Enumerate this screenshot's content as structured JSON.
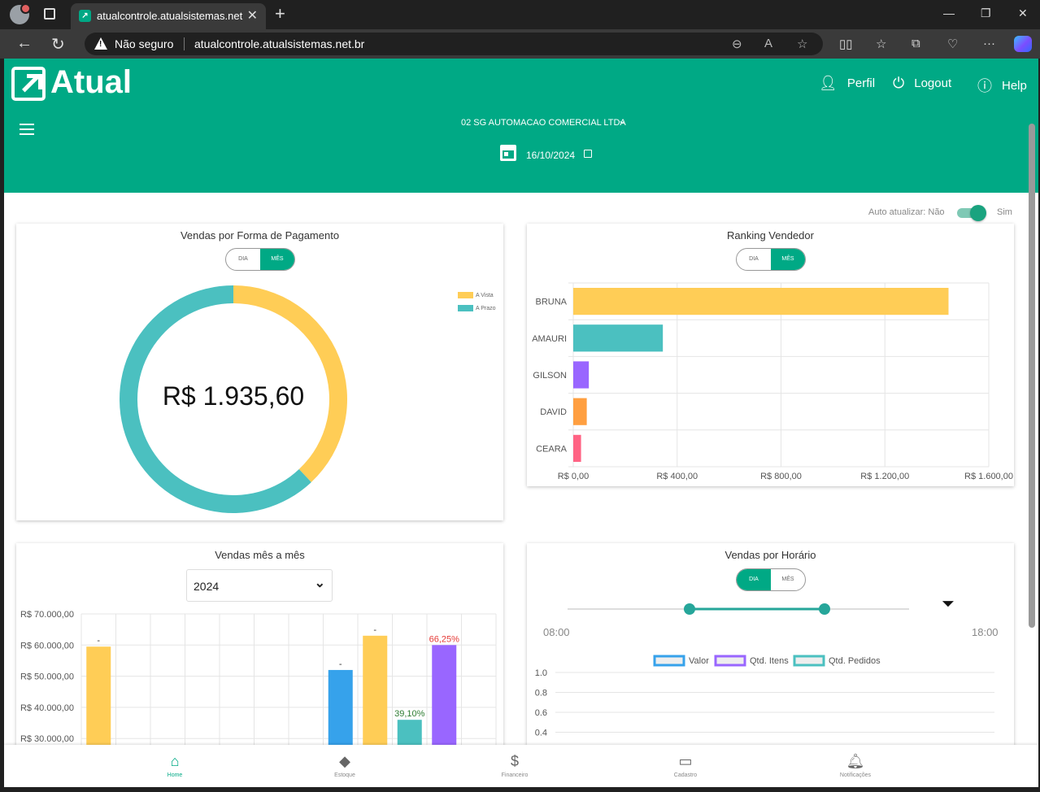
{
  "browser": {
    "tab_title": "atualcontrole.atualsistemas.net.br",
    "security": "Não seguro",
    "url": "atualcontrole.atualsistemas.net.br"
  },
  "header": {
    "logo_text": "Atual",
    "perfil": "Perfil",
    "logout": "Logout",
    "help": "Help",
    "company": "02 SG AUTOMACAO COMERCIAL LTDA",
    "date": "16/10/2024"
  },
  "auto_update": {
    "label": "Auto atualizar: Não",
    "on_label": "Sim",
    "enabled": true
  },
  "cards": {
    "payment": {
      "title": "Vendas por Forma de Pagamento",
      "seg_dia": "DIA",
      "seg_mes": "MÊS",
      "active": "MÊS",
      "total": "R$ 1.935,60"
    },
    "ranking": {
      "title": "Ranking Vendedor",
      "seg_dia": "DIA",
      "seg_mes": "MÊS",
      "active": "MÊS"
    },
    "monthly": {
      "title": "Vendas mês a mês",
      "year": "2024"
    },
    "hourly": {
      "title": "Vendas por Horário",
      "seg_dia": "DIA",
      "seg_mes": "MÊS",
      "active": "DIA",
      "start": "08:00",
      "end": "18:00"
    }
  },
  "bottom_nav": [
    {
      "label": "Home",
      "icon": "home-icon"
    },
    {
      "label": "Estoque",
      "icon": "tag-icon"
    },
    {
      "label": "Financeiro",
      "icon": "dollar-icon"
    },
    {
      "label": "Cadastro",
      "icon": "folder-icon"
    },
    {
      "label": "Notificações",
      "icon": "bell-icon"
    }
  ],
  "colors": {
    "brand": "#00a985",
    "yellow": "#ffcd56",
    "teal": "#4bc0c0",
    "purple": "#9966ff",
    "orange": "#ff9f40",
    "pink": "#ff6384",
    "blue": "#36a2eb"
  },
  "chart_data": [
    {
      "type": "pie",
      "title": "Vendas por Forma de Pagamento",
      "categories": [
        "A Vista",
        "A Prazo"
      ],
      "values": [
        38,
        62
      ],
      "colors": [
        "#ffcd56",
        "#4bc0c0"
      ],
      "legend": "top-right"
    },
    {
      "type": "bar",
      "title": "Ranking Vendedor",
      "orientation": "horizontal",
      "categories": [
        "BRUNA",
        "AMAURI",
        "GILSON",
        "DAVID",
        "CEARA"
      ],
      "values": [
        1445,
        345,
        60,
        52,
        30
      ],
      "colors": [
        "#ffcd56",
        "#4bc0c0",
        "#9966ff",
        "#ff9f40",
        "#ff6384"
      ],
      "ticks": [
        "R$ 0,00",
        "R$ 400,00",
        "R$ 800,00",
        "R$ 1.200,00",
        "R$ 1.600,00"
      ],
      "xlim": [
        0,
        1600
      ]
    },
    {
      "type": "bar",
      "title": "Vendas mês a mês",
      "slots": 12,
      "ticks": [
        "R$ 70.000,00",
        "R$ 60.000,00",
        "R$ 50.000,00",
        "R$ 40.000,00",
        "R$ 30.000,00"
      ],
      "ylim": [
        30000,
        70000
      ],
      "bars": [
        {
          "slot": 0,
          "value": 59500,
          "color": "#ffcd56",
          "label": "-",
          "label_color": "#333"
        },
        {
          "slot": 7,
          "value": 52000,
          "color": "#36a2eb",
          "label": "-",
          "label_color": "#333"
        },
        {
          "slot": 8,
          "value": 63000,
          "color": "#ffcd56",
          "label": "-",
          "label_color": "#333"
        },
        {
          "slot": 9,
          "value": 36000,
          "color": "#4bc0c0",
          "label": "39,10%",
          "label_color": "#2e7d32"
        },
        {
          "slot": 10,
          "value": 60000,
          "color": "#9966ff",
          "label": "66,25%",
          "label_color": "#e53935"
        }
      ]
    },
    {
      "type": "line",
      "title": "Vendas por Horário",
      "series": [
        {
          "name": "Valor",
          "color": "#36a2eb",
          "values": []
        },
        {
          "name": "Qtd. Itens",
          "color": "#9966ff",
          "values": []
        },
        {
          "name": "Qtd. Pedidos",
          "color": "#4bc0c0",
          "values": []
        }
      ],
      "yticks": [
        "1.0",
        "0.8",
        "0.6",
        "0.4"
      ],
      "ylim": [
        0,
        1
      ]
    }
  ]
}
